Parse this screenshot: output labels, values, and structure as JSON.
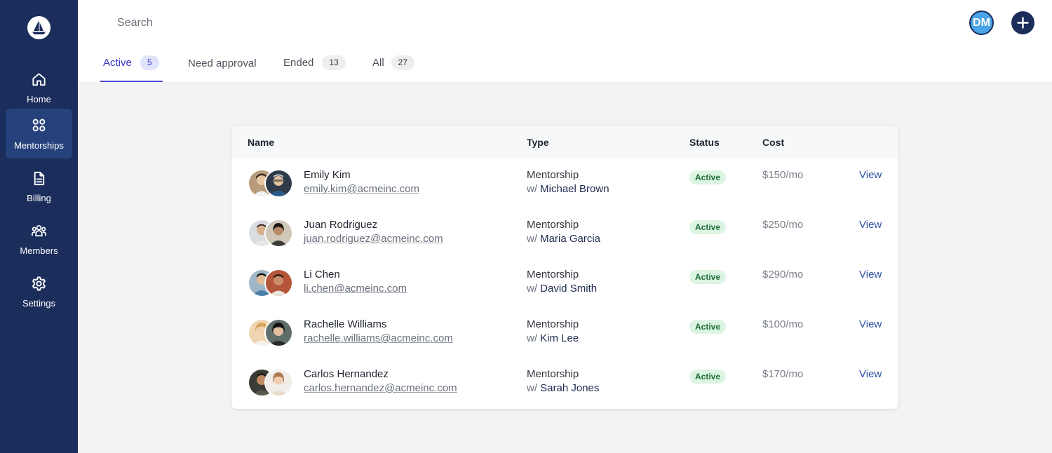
{
  "search": {
    "placeholder": "Search"
  },
  "user": {
    "initials": "DM"
  },
  "sidebar": {
    "items": [
      {
        "label": "Home",
        "icon": "home-icon"
      },
      {
        "label": "Mentorships",
        "icon": "grid-icon",
        "active": true
      },
      {
        "label": "Billing",
        "icon": "document-icon"
      },
      {
        "label": "Members",
        "icon": "people-icon"
      },
      {
        "label": "Settings",
        "icon": "gear-icon"
      }
    ]
  },
  "tabs": [
    {
      "label": "Active",
      "count": "5",
      "active": true
    },
    {
      "label": "Need approval",
      "count": ""
    },
    {
      "label": "Ended",
      "count": "13"
    },
    {
      "label": "All",
      "count": "27"
    }
  ],
  "table": {
    "headers": {
      "name": "Name",
      "type": "Type",
      "status": "Status",
      "cost": "Cost"
    },
    "rows": [
      {
        "name": "Emily Kim",
        "email": "emily.kim@acmeinc.com",
        "type": "Mentorship",
        "with_prefix": "w/",
        "mentor": "Michael Brown",
        "status": "Active",
        "cost": "$150/mo",
        "action": "View"
      },
      {
        "name": "Juan Rodriguez",
        "email": "juan.rodriguez@acmeinc.com",
        "type": "Mentorship",
        "with_prefix": "w/",
        "mentor": "Maria Garcia",
        "status": "Active",
        "cost": "$250/mo",
        "action": "View"
      },
      {
        "name": "Li Chen",
        "email": "li.chen@acmeinc.com",
        "type": "Mentorship",
        "with_prefix": "w/",
        "mentor": "David Smith",
        "status": "Active",
        "cost": "$290/mo",
        "action": "View"
      },
      {
        "name": "Rachelle Williams",
        "email": "rachelle.williams@acmeinc.com",
        "type": "Mentorship",
        "with_prefix": "w/",
        "mentor": "Kim Lee",
        "status": "Active",
        "cost": "$100/mo",
        "action": "View"
      },
      {
        "name": "Carlos Hernandez",
        "email": "carlos.hernandez@acmeinc.com",
        "type": "Mentorship",
        "with_prefix": "w/",
        "mentor": "Sarah Jones",
        "status": "Active",
        "cost": "$170/mo",
        "action": "View"
      }
    ]
  },
  "colors": {
    "sidebar_bg": "#1a2d5b",
    "sidebar_active": "#26427c",
    "accent": "#4a46d6",
    "status_active_bg": "#dcf5e3",
    "status_active_text": "#1d6b37",
    "link": "#2c4fa3"
  }
}
